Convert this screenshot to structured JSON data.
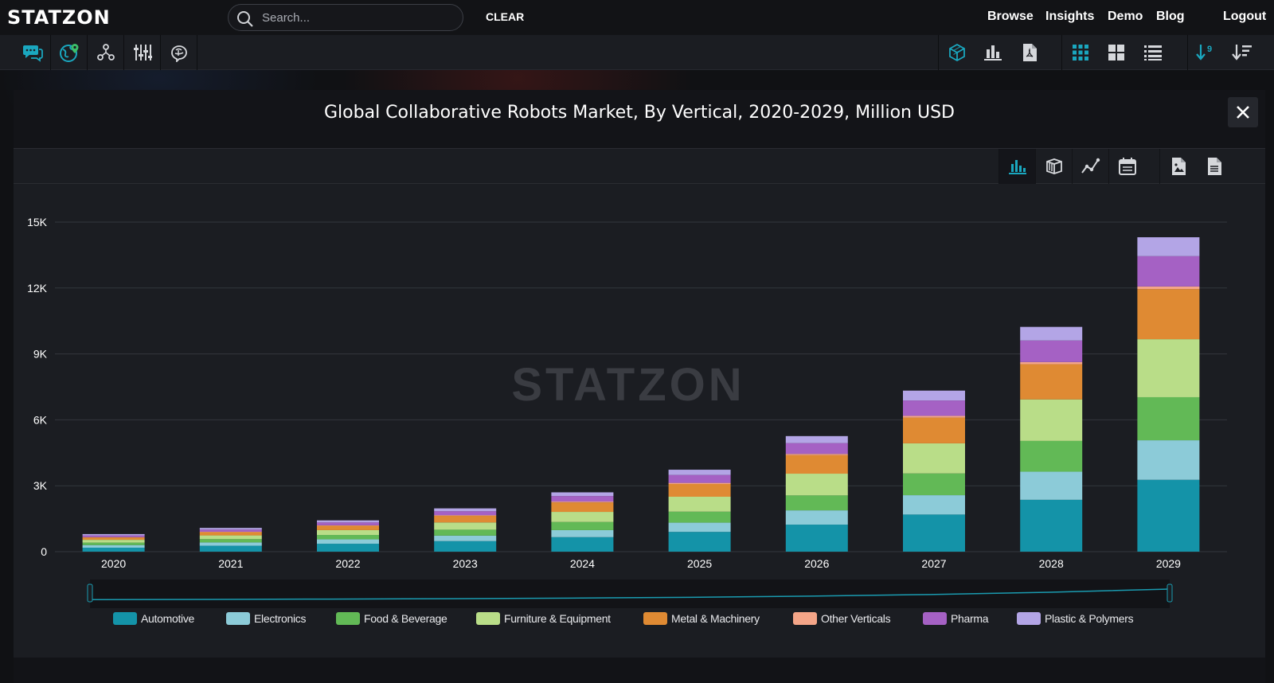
{
  "brand": {
    "logo_text": "STATZON"
  },
  "search": {
    "placeholder": "Search...",
    "clear_label": "CLEAR"
  },
  "nav": {
    "browse": "Browse",
    "insights": "Insights",
    "demo": "Demo",
    "blog": "Blog",
    "logout": "Logout"
  },
  "toolbar": {
    "sort_badge": "9",
    "accent_color": "#1a9bb0"
  },
  "watermark": "STATZON",
  "chart_data": {
    "type": "bar",
    "stacked": true,
    "title": "Global Collaborative Robots Market, By Vertical, 2020-2029, Million USD",
    "xlabel": "",
    "ylabel": "",
    "ylim": [
      0,
      15000
    ],
    "yticks": [
      0,
      3000,
      6000,
      9000,
      12000,
      15000
    ],
    "ytick_labels": [
      "0",
      "3K",
      "6K",
      "9K",
      "12K",
      "15K"
    ],
    "grid": true,
    "legend_position": "bottom",
    "categories": [
      "2020",
      "2021",
      "2022",
      "2023",
      "2024",
      "2025",
      "2026",
      "2027",
      "2028",
      "2029"
    ],
    "series": [
      {
        "name": "Automotive",
        "color": "#1493a8",
        "values": [
          180,
          270,
          360,
          480,
          660,
          900,
          1230,
          1690,
          2360,
          3270
        ]
      },
      {
        "name": "Electronics",
        "color": "#8ccbd8",
        "values": [
          120,
          150,
          200,
          250,
          320,
          420,
          650,
          880,
          1280,
          1800
        ]
      },
      {
        "name": "Food & Beverage",
        "color": "#62b956",
        "values": [
          110,
          150,
          200,
          270,
          370,
          500,
          680,
          990,
          1400,
          1960
        ]
      },
      {
        "name": "Furniture & Equipment",
        "color": "#b9dd88",
        "values": [
          130,
          170,
          220,
          330,
          460,
          680,
          990,
          1370,
          1890,
          2640
        ]
      },
      {
        "name": "Metal & Machinery",
        "color": "#df8a33",
        "values": [
          110,
          150,
          200,
          300,
          430,
          580,
          840,
          1170,
          1600,
          2280
        ]
      },
      {
        "name": "Other Verticals",
        "color": "#f4a588",
        "values": [
          10,
          15,
          20,
          30,
          40,
          50,
          60,
          80,
          100,
          120
        ]
      },
      {
        "name": "Pharma",
        "color": "#a561c4",
        "values": [
          80,
          100,
          130,
          180,
          250,
          360,
          490,
          700,
          980,
          1380
        ]
      },
      {
        "name": "Plastic & Polymers",
        "color": "#b3a5e6",
        "values": [
          60,
          75,
          95,
          130,
          170,
          240,
          320,
          450,
          620,
          860
        ]
      }
    ]
  }
}
